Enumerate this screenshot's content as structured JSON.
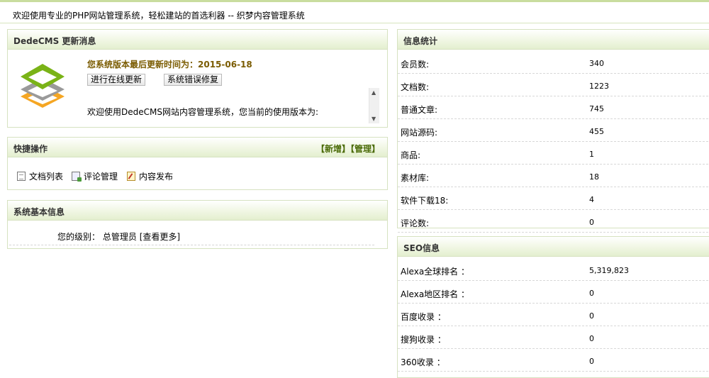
{
  "header": {
    "welcome": "欢迎使用专业的PHP网站管理系统，轻松建站的首选利器 -- 织梦内容管理系统"
  },
  "update_panel": {
    "title": "DedeCMS 更新消息",
    "last_update": "您系统版本最后更新时间为：2015-06-18",
    "online_update_button": "进行在线更新",
    "repair_button": "系统错误修复",
    "message": "欢迎使用DedeCMS网站内容管理系统，您当前的使用版本为:"
  },
  "quick_panel": {
    "title": "快捷操作",
    "add_link": "【新增】",
    "manage_link": "【管理】",
    "items": [
      {
        "label": "文档列表",
        "icon": "document-list-icon"
      },
      {
        "label": "评论管理",
        "icon": "comment-icon"
      },
      {
        "label": "内容发布",
        "icon": "publish-icon"
      }
    ]
  },
  "sys_panel": {
    "title": "系统基本信息",
    "level_label": "您的级别：",
    "level_value": "总管理员",
    "more_link": "[查看更多]"
  },
  "stats_panel": {
    "title": "信息统计",
    "rows": [
      {
        "label": "会员数:",
        "value": "340"
      },
      {
        "label": "文档数:",
        "value": "1223"
      },
      {
        "label": "普通文章:",
        "value": "745"
      },
      {
        "label": "网站源码:",
        "value": "455"
      },
      {
        "label": "商品:",
        "value": "1"
      },
      {
        "label": "素材库:",
        "value": "18"
      },
      {
        "label": "软件下载18:",
        "value": "4"
      },
      {
        "label": "评论数:",
        "value": "0"
      }
    ]
  },
  "seo_panel": {
    "title": "SEO信息",
    "rows": [
      {
        "label": "Alexa全球排名 ：",
        "value": "5,319,823"
      },
      {
        "label": "Alexa地区排名 ：",
        "value": "0"
      },
      {
        "label": "百度收录 ：",
        "value": "0"
      },
      {
        "label": "搜狗收录 ：",
        "value": "0"
      },
      {
        "label": "360收录 ：",
        "value": "0"
      }
    ]
  },
  "colors": {
    "accent_green": "#4b6b08",
    "panel_border": "#d6e2c0",
    "header_gradient_end": "#e4efcf",
    "update_time": "#7a5b00"
  }
}
